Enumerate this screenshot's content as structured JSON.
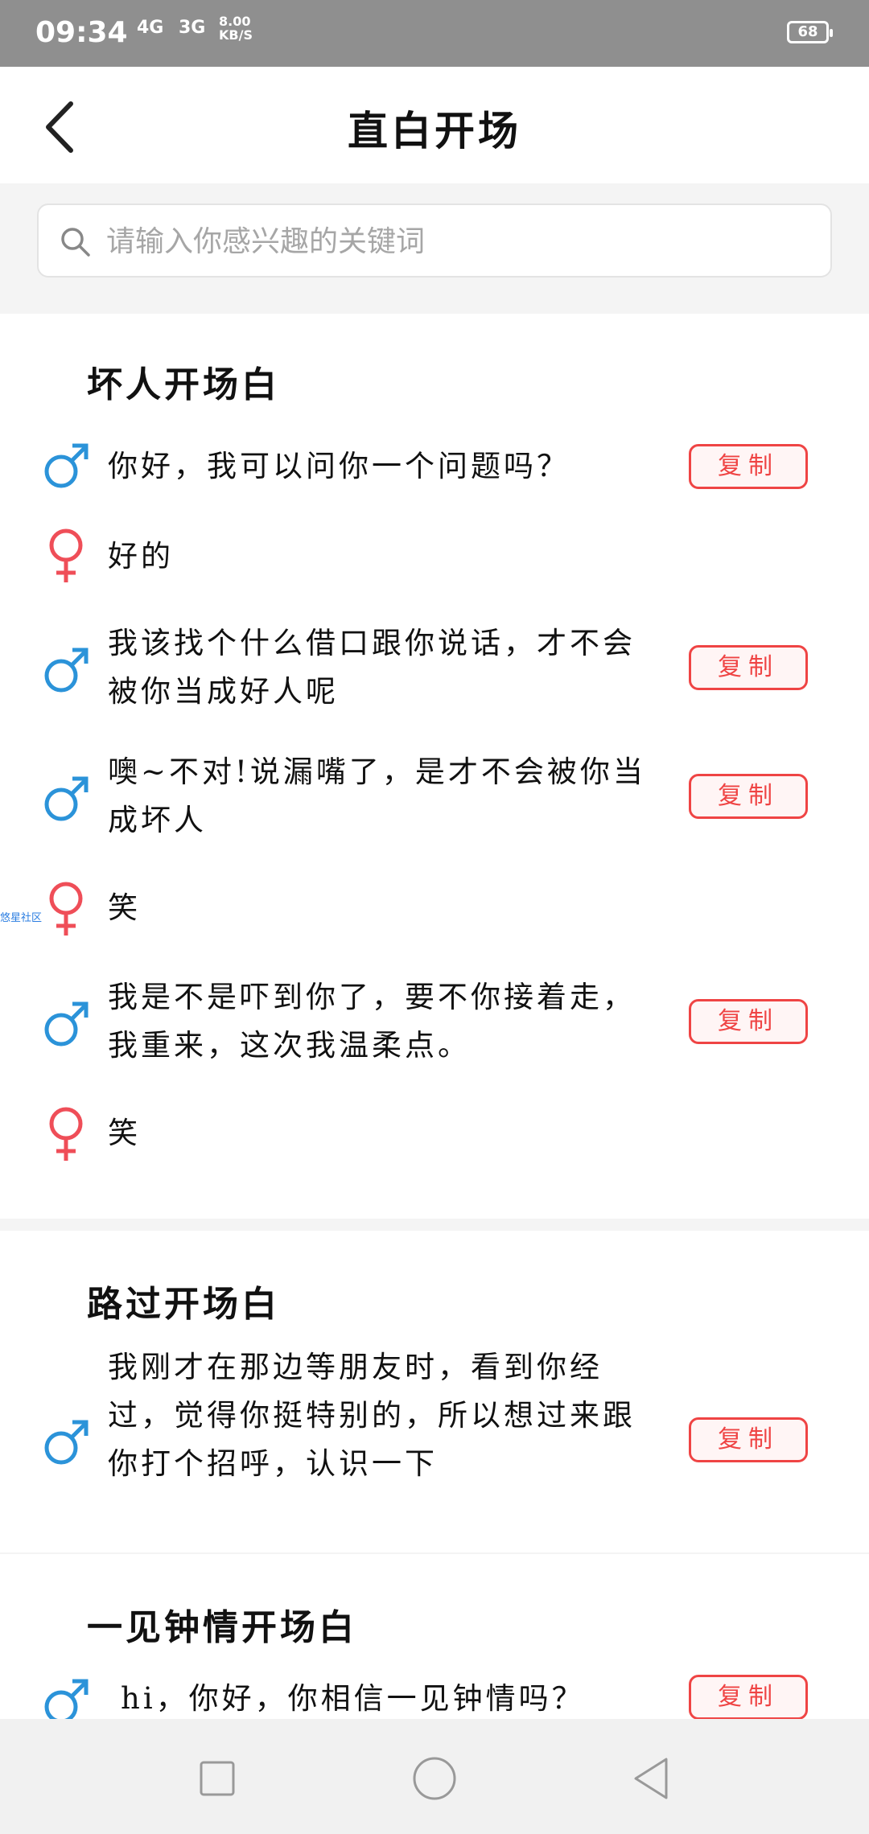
{
  "status_bar": {
    "time": "09:34",
    "net1": "4G",
    "net2": "3G",
    "speed_value": "8.00",
    "speed_unit": "KB/S",
    "battery": "68"
  },
  "header": {
    "title": "直白开场"
  },
  "search": {
    "placeholder": "请输入你感兴趣的关键词"
  },
  "copy_label": "复制",
  "watermark": "悠星社区",
  "sections": [
    {
      "title": "坏人开场白",
      "items": [
        {
          "gender": "male",
          "text": "你好，我可以问你一个问题吗？",
          "copyable": true
        },
        {
          "gender": "female",
          "text": "好的",
          "copyable": false
        },
        {
          "gender": "male",
          "text": "我该找个什么借口跟你说话，才不会被你当成好人呢",
          "copyable": true
        },
        {
          "gender": "male",
          "text": "噢~不对!说漏嘴了，是才不会被你当成坏人",
          "copyable": true
        },
        {
          "gender": "female",
          "text": "笑",
          "copyable": false
        },
        {
          "gender": "male",
          "text": "我是不是吓到你了，要不你接着走，我重来，这次我温柔点。",
          "copyable": true
        },
        {
          "gender": "female",
          "text": "笑",
          "copyable": false
        }
      ]
    },
    {
      "title": "路过开场白",
      "items": [
        {
          "gender": "male",
          "text": "我刚才在那边等朋友时，看到你经过，觉得你挺特别的，所以想过来跟你打个招呼，认识一下",
          "copyable": true
        }
      ]
    },
    {
      "title": "一见钟情开场白",
      "items": [
        {
          "gender": "male",
          "text": "hi，你好，你相信一见钟情吗？",
          "copyable": true
        }
      ]
    }
  ],
  "colors": {
    "male": "#2b93d9",
    "female": "#ef4e58",
    "accent": "#ef4444"
  }
}
